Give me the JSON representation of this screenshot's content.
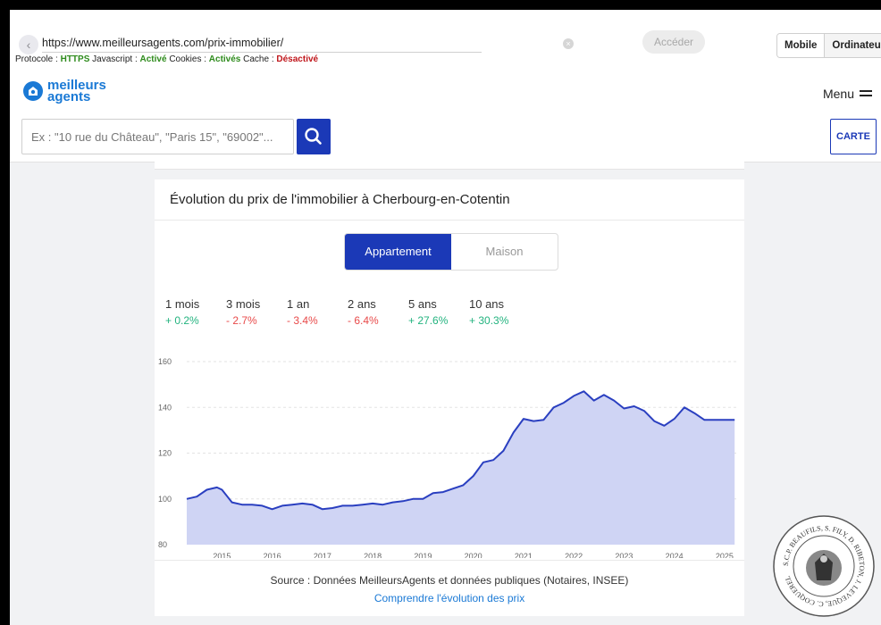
{
  "browser": {
    "url": "https://www.meilleursagents.com/prix-immobilier/",
    "protocol_label": "Protocole :",
    "protocol_value": "HTTPS",
    "js_label": "Javascript :",
    "js_value": "Activé",
    "cookies_label": "Cookies :",
    "cookies_value": "Activés",
    "cache_label": "Cache :",
    "cache_value": "Désactivé",
    "go_label": "Accéder",
    "mode_mobile": "Mobile",
    "mode_desktop": "Ordinateur"
  },
  "site": {
    "logo_line1": "meilleurs",
    "logo_line2": "agents",
    "menu_label": "Menu",
    "search_placeholder": "Ex : \"10 rue du Château\", \"Paris 15\", \"69002\"...",
    "map_button": "CARTE"
  },
  "card": {
    "title": "Évolution du prix de l'immobilier à Cherbourg-en-Cotentin",
    "tabs": [
      {
        "label": "Appartement",
        "active": true
      },
      {
        "label": "Maison",
        "active": false
      }
    ],
    "periods": [
      {
        "label": "1 mois",
        "value": "+ 0.2%",
        "trend": "up"
      },
      {
        "label": "3 mois",
        "value": "- 2.7%",
        "trend": "down"
      },
      {
        "label": "1 an",
        "value": "- 3.4%",
        "trend": "down"
      },
      {
        "label": "2 ans",
        "value": "- 6.4%",
        "trend": "down"
      },
      {
        "label": "5 ans",
        "value": "+ 27.6%",
        "trend": "up"
      },
      {
        "label": "10 ans",
        "value": "+ 30.3%",
        "trend": "up"
      }
    ],
    "source": "Source : Données MeilleursAgents et données publiques (Notaires, INSEE)",
    "learn_more": "Comprendre l'évolution des prix"
  },
  "colors": {
    "accent": "#1b39b7",
    "line": "#2a3fc0",
    "area": "#cfd4f4",
    "positive": "#23b37f",
    "negative": "#e84a4a",
    "link": "#1a79d5"
  },
  "icons": {
    "back": "chevron-left-icon",
    "clear": "clear-icon",
    "search": "search-icon",
    "menu": "hamburger-icon",
    "logo": "house-pin-icon"
  },
  "chart_data": {
    "type": "area",
    "title": "",
    "xlabel": "",
    "ylabel": "",
    "ylim": [
      80,
      160
    ],
    "yticks": [
      80,
      100,
      120,
      140,
      160
    ],
    "xlim": [
      2014.3,
      2025.25
    ],
    "xticks": [
      2015,
      2016,
      2017,
      2018,
      2019,
      2020,
      2021,
      2022,
      2023,
      2024,
      2025
    ],
    "grid": true,
    "legend": "none",
    "series": [
      {
        "x": [
          2014.3,
          2014.5,
          2014.7,
          2014.9,
          2015.0,
          2015.2,
          2015.4,
          2015.6,
          2015.8,
          2016.0,
          2016.2,
          2016.4,
          2016.6,
          2016.8,
          2017.0,
          2017.2,
          2017.4,
          2017.6,
          2017.8,
          2018.0,
          2018.2,
          2018.4,
          2018.6,
          2018.8,
          2019.0,
          2019.2,
          2019.4,
          2019.6,
          2019.8,
          2020.0,
          2020.2,
          2020.4,
          2020.6,
          2020.8,
          2021.0,
          2021.2,
          2021.4,
          2021.6,
          2021.8,
          2022.0,
          2022.2,
          2022.4,
          2022.6,
          2022.8,
          2023.0,
          2023.2,
          2023.4,
          2023.6,
          2023.8,
          2024.0,
          2024.2,
          2024.4,
          2024.6,
          2024.8,
          2025.0,
          2025.2
        ],
        "values": [
          100,
          101,
          104,
          105,
          104,
          98.5,
          97.5,
          97.5,
          97,
          95.5,
          97,
          97.5,
          98,
          97.5,
          95.5,
          96,
          97,
          97,
          97.5,
          98,
          97.5,
          98.5,
          99,
          100,
          100,
          102.5,
          103,
          104.5,
          106,
          110,
          116,
          117,
          121,
          129,
          135,
          134,
          134.5,
          140,
          142,
          145,
          147,
          143,
          145.5,
          143,
          139.5,
          140.5,
          138.5,
          134,
          132,
          135,
          140,
          137.5,
          134.5,
          134.5,
          134.5,
          134.5
        ]
      }
    ]
  }
}
